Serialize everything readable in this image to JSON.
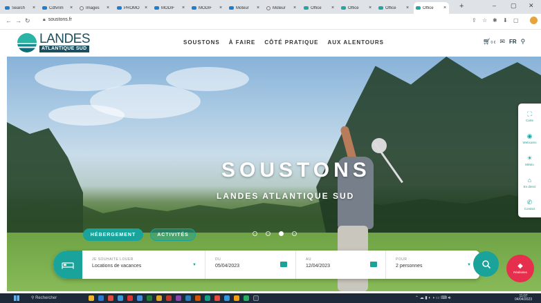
{
  "browser": {
    "tabs": [
      {
        "label": "Search",
        "icon": "globe-icon",
        "active": false
      },
      {
        "label": "Cdfvnm",
        "icon": "globe-icon",
        "active": false
      },
      {
        "label": "Images",
        "icon": "ring-icon",
        "active": false
      },
      {
        "label": "PROMO",
        "icon": "globe-icon",
        "active": false
      },
      {
        "label": "MODIF",
        "icon": "globe-icon",
        "active": false
      },
      {
        "label": "MODIF",
        "icon": "globe-icon",
        "active": false
      },
      {
        "label": "Moteur",
        "icon": "globe-icon",
        "active": false
      },
      {
        "label": "Moteur",
        "icon": "ring-icon",
        "active": false
      },
      {
        "label": "Office",
        "icon": "teal-icon",
        "active": false
      },
      {
        "label": "Office",
        "icon": "teal-icon",
        "active": false
      },
      {
        "label": "Office",
        "icon": "teal-icon",
        "active": false
      },
      {
        "label": "Office",
        "icon": "teal-icon",
        "active": true
      }
    ],
    "new_tab": "+",
    "url": "soustons.fr"
  },
  "site": {
    "logo_top": "LANDES",
    "logo_bottom": "ATLANTIQUE SUD",
    "nav": [
      "SOUSTONS",
      "À FAIRE",
      "CÔTÉ PRATIQUE",
      "AUX ALENTOURS"
    ],
    "cart_count": "0 €",
    "lang": "FR"
  },
  "hero": {
    "title": "SOUSTONS",
    "subtitle": "LANDES ATLANTIQUE SUD",
    "pills": [
      "HÉBERGEMENT",
      "ACTIVITÉS"
    ],
    "slides": 4,
    "active_slide": 2
  },
  "search": {
    "type_label": "Je souhaite louer",
    "type_value": "Locations de vacances",
    "from_label": "Du",
    "from_value": "05/04/2023",
    "to_label": "Au",
    "to_value": "12/04/2023",
    "guests_label": "Pour",
    "guests_value": "2 personnes"
  },
  "widget": {
    "label": "Réalisées"
  },
  "sidepanel": [
    {
      "label": "Carte",
      "icon": "map-icon"
    },
    {
      "label": "Webcams",
      "icon": "webcam-icon"
    },
    {
      "label": "Météo",
      "icon": "weather-icon"
    },
    {
      "label": "En direct",
      "icon": "live-icon"
    },
    {
      "label": "Contact",
      "icon": "phone-icon"
    }
  ],
  "taskbar": {
    "search": "Rechercher",
    "time": "11:07",
    "date": "04/04/2023"
  },
  "colors": {
    "brand": "#1aa39a",
    "accent": "#e62e4d",
    "logo_dark": "#1b4f5d"
  }
}
